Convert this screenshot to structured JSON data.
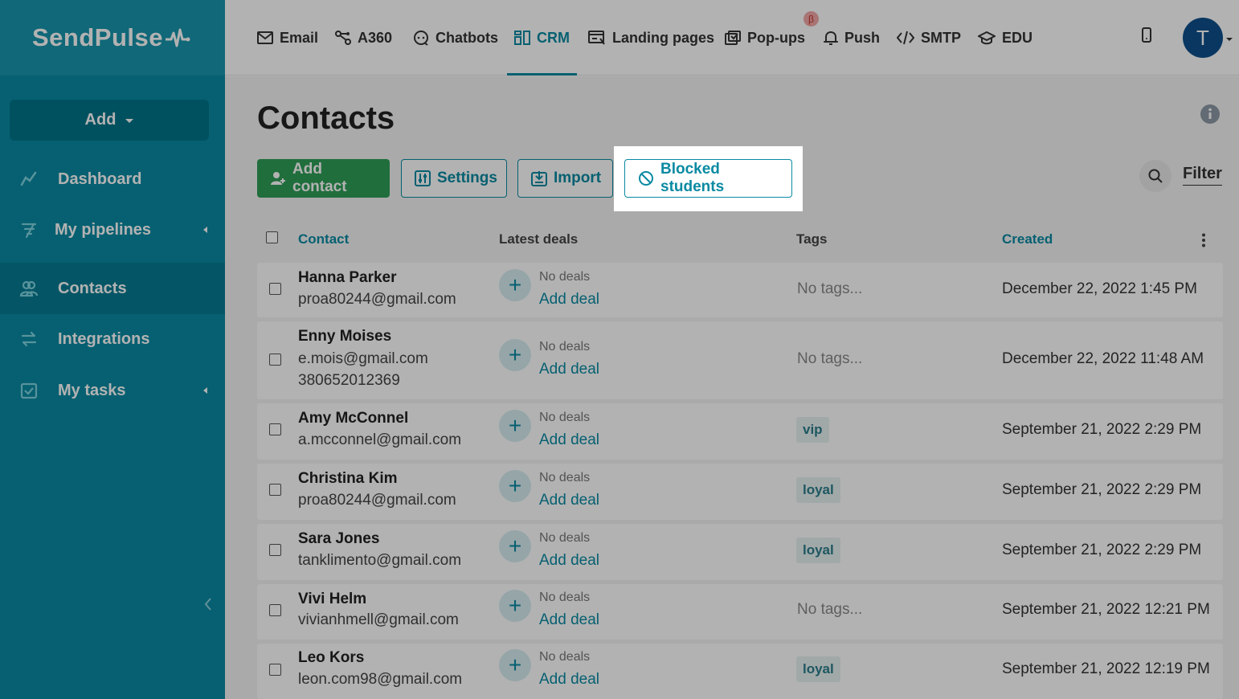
{
  "sidebar": {
    "logo": "SendPulse",
    "add_label": "Add",
    "items": [
      {
        "label": "Dashboard",
        "icon": "chart-line-icon"
      },
      {
        "label": "My pipelines",
        "icon": "pipeline-icon"
      },
      {
        "label": "Contacts",
        "icon": "contacts-icon"
      },
      {
        "label": "Integrations",
        "icon": "integrations-icon"
      },
      {
        "label": "My tasks",
        "icon": "tasks-icon"
      }
    ]
  },
  "topnav": {
    "tabs": [
      {
        "label": "Email",
        "icon": "envelope-icon"
      },
      {
        "label": "A360",
        "icon": "a360-icon"
      },
      {
        "label": "Chatbots",
        "icon": "chatbot-icon"
      },
      {
        "label": "CRM",
        "icon": "crm-icon"
      },
      {
        "label": "Landing pages",
        "icon": "landing-icon"
      },
      {
        "label": "Pop-ups",
        "icon": "popup-icon"
      },
      {
        "label": "Push",
        "icon": "bell-icon"
      },
      {
        "label": "SMTP",
        "icon": "code-icon"
      },
      {
        "label": "EDU",
        "icon": "graduation-cap-icon"
      }
    ],
    "active_tab": "CRM",
    "beta_badge": "β",
    "avatar_letter": "T"
  },
  "page": {
    "title": "Contacts",
    "buttons": {
      "add_contact": "Add contact",
      "settings": "Settings",
      "import": "Import",
      "blocked_students": "Blocked students"
    },
    "filter_label": "Filter"
  },
  "table": {
    "columns": {
      "contact": "Contact",
      "latest_deals": "Latest deals",
      "tags": "Tags",
      "created": "Created"
    },
    "rows": [
      {
        "name": "Hanna Parker",
        "lines": [
          "proa80244@gmail.com"
        ],
        "deals": "No deals",
        "add_deal": "Add deal",
        "tags": "No tags...",
        "tag": "",
        "created": "December 22, 2022 1:45 PM"
      },
      {
        "name": "Enny Moises",
        "lines": [
          "e.mois@gmail.com",
          "380652012369"
        ],
        "deals": "No deals",
        "add_deal": "Add deal",
        "tags": "No tags...",
        "tag": "",
        "created": "December 22, 2022 11:48 AM"
      },
      {
        "name": "Amy McConnel",
        "lines": [
          "a.mcconnel@gmail.com"
        ],
        "deals": "No deals",
        "add_deal": "Add deal",
        "tags": "",
        "tag": "vip",
        "created": "September 21, 2022 2:29 PM"
      },
      {
        "name": "Christina Kim",
        "lines": [
          "proa80244@gmail.com"
        ],
        "deals": "No deals",
        "add_deal": "Add deal",
        "tags": "",
        "tag": "loyal",
        "created": "September 21, 2022 2:29 PM"
      },
      {
        "name": "Sara Jones",
        "lines": [
          "tanklimento@gmail.com"
        ],
        "deals": "No deals",
        "add_deal": "Add deal",
        "tags": "",
        "tag": "loyal",
        "created": "September 21, 2022 2:29 PM"
      },
      {
        "name": "Vivi Helm",
        "lines": [
          "vivianhmell@gmail.com"
        ],
        "deals": "No deals",
        "add_deal": "Add deal",
        "tags": "No tags...",
        "tag": "",
        "created": "September 21, 2022 12:21 PM"
      },
      {
        "name": "Leo Kors",
        "lines": [
          "leon.com98@gmail.com"
        ],
        "deals": "No deals",
        "add_deal": "Add deal",
        "tags": "",
        "tag": "loyal",
        "created": "September 21, 2022 12:19 PM"
      }
    ]
  },
  "colors": {
    "brand": "#0a8aa2",
    "sidebar": "#0a8aa2",
    "green": "#2f9e56",
    "avatar": "#0d4f8c"
  }
}
